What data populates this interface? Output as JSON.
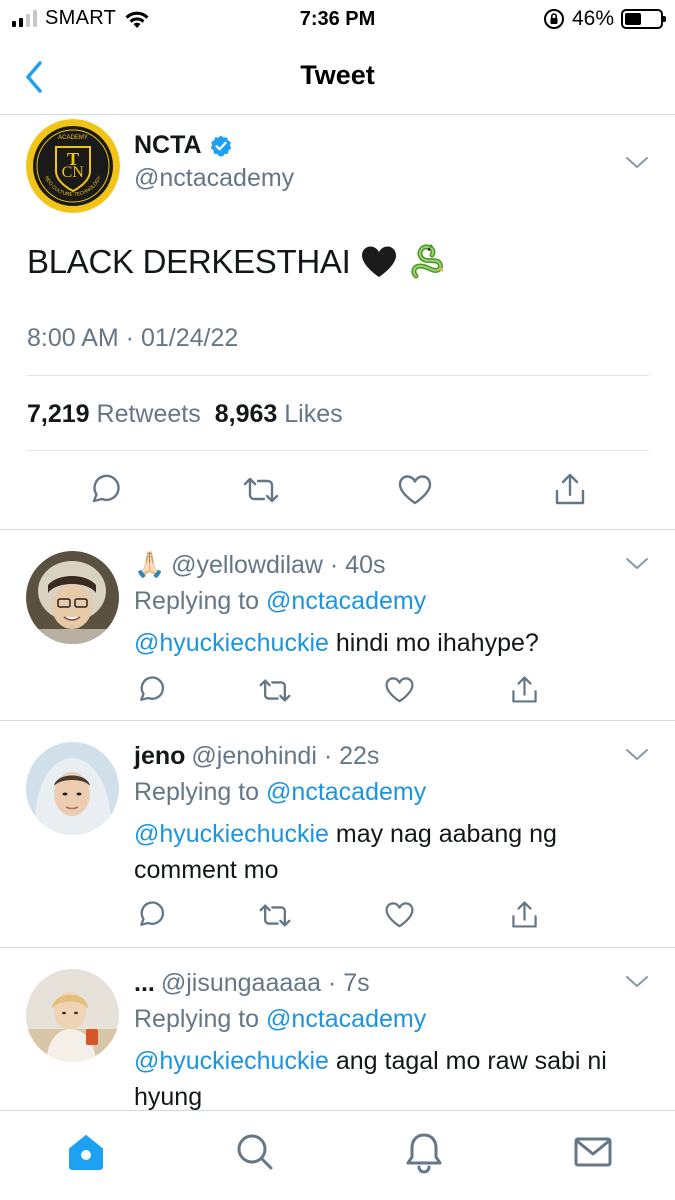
{
  "status_bar": {
    "carrier": "SMART",
    "time": "7:36 PM",
    "battery": "46%",
    "battery_level": 0.46
  },
  "nav": {
    "title": "Tweet"
  },
  "tweet": {
    "author_name": "NCTA",
    "handle": "@nctacademy",
    "text": "BLACK DERKESTHAI",
    "emojis": [
      "black-heart",
      "dragon"
    ],
    "timestamp": "8:00 AM · 01/24/22",
    "retweet_count": "7,219",
    "retweet_label": "Retweets",
    "like_count": "8,963",
    "like_label": "Likes",
    "logo_text_top": "ACADEMY",
    "logo_text_ring": "NEO CULTURE TECHNOLOGY"
  },
  "replies": [
    {
      "name": "🙏🏻",
      "handle_time": "@yellowdilaw · 40s",
      "replying_label": "Replying to",
      "replying_to": "@nctacademy",
      "mention": "@hyuckiechuckie",
      "text": " hindi mo ihahype?"
    },
    {
      "name": "jeno",
      "handle_time": "@jenohindi · 22s",
      "replying_label": "Replying to",
      "replying_to": "@nctacademy",
      "mention": "@hyuckiechuckie",
      "text": " may nag aabang ng comment mo"
    },
    {
      "name": "...",
      "handle_time": "@jisungaaaaa · 7s",
      "replying_label": "Replying to",
      "replying_to": "@nctacademy",
      "mention": "@hyuckiechuckie",
      "text": " ang tagal mo raw sabi ni hyung"
    }
  ],
  "colors": {
    "accent": "#1da1f2",
    "link": "#1b95e0",
    "secondary_text": "#657786",
    "divider": "#cfd9de",
    "verified": "#1da1f2",
    "logo_gold": "#f2c417"
  }
}
